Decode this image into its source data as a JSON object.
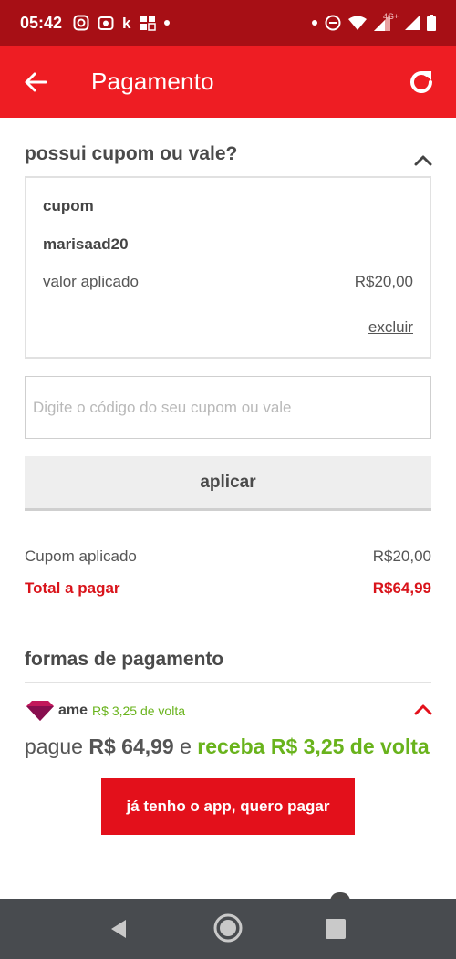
{
  "status_bar": {
    "time": "05:42",
    "network_label": "4G+",
    "left_icons": [
      "instagram-icon",
      "camera-icon",
      "k-icon",
      "grid-icon"
    ],
    "right_icons": [
      "dnd-icon",
      "wifi-icon",
      "signal-icon",
      "battery-icon"
    ]
  },
  "app_bar": {
    "title": "Pagamento",
    "back_icon": "arrow-left-icon",
    "refresh_icon": "refresh-icon"
  },
  "coupon_section": {
    "heading": "possui cupom ou vale?",
    "applied": {
      "type_label": "cupom",
      "code": "marisaad20",
      "value_label": "valor aplicado",
      "value": "R$20,00",
      "remove_label": "excluir"
    },
    "input_placeholder": "Digite o código do seu cupom ou vale",
    "apply_label": "aplicar"
  },
  "summary": {
    "coupon_label": "Cupom aplicado",
    "coupon_value": "R$20,00",
    "total_label": "Total a pagar",
    "total_value": "R$64,99"
  },
  "payment_section": {
    "heading": "formas de pagamento",
    "ame": {
      "name": "ame",
      "cashback_badge": "R$ 3,25 de volta",
      "pay_prefix": "pague",
      "pay_amount": "R$ 64,99",
      "pay_conj": "e",
      "receive_text": "receba R$ 3,25 de volta",
      "button_label": "já tenho o app, quero pagar"
    }
  },
  "colors": {
    "status_bar": "#a70f15",
    "app_bar": "#ee1d23",
    "primary_red": "#e3101b",
    "cashback_green": "#69b31c",
    "nav_bar": "#484b4f"
  }
}
